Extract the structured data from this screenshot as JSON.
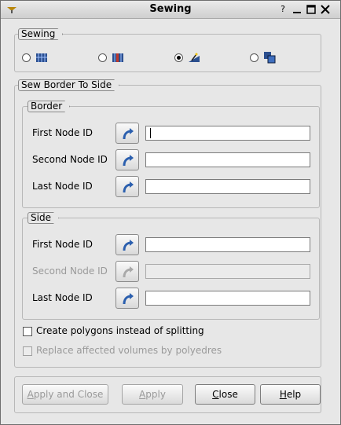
{
  "window": {
    "title": "Sewing",
    "help_label": "?",
    "controls": [
      "help",
      "minimize",
      "maximize",
      "close"
    ]
  },
  "sewing_group": {
    "legend": "Sewing",
    "options": [
      {
        "icon": "free-borders-icon",
        "selected": false
      },
      {
        "icon": "conform-free-borders-icon",
        "selected": false
      },
      {
        "icon": "border-to-side-icon",
        "selected": true
      },
      {
        "icon": "side-elements-icon",
        "selected": false
      }
    ]
  },
  "sew_group": {
    "legend": "Sew Border To Side",
    "border": {
      "legend": "Border",
      "rows": [
        {
          "label": "First Node ID",
          "value": "",
          "enabled": true
        },
        {
          "label": "Second Node ID",
          "value": "",
          "enabled": true
        },
        {
          "label": "Last Node ID",
          "value": "",
          "enabled": true
        }
      ]
    },
    "side": {
      "legend": "Side",
      "rows": [
        {
          "label": "First Node ID",
          "value": "",
          "enabled": true
        },
        {
          "label": "Second Node ID",
          "value": "",
          "enabled": false
        },
        {
          "label": "Last Node ID",
          "value": "",
          "enabled": true
        }
      ]
    },
    "options": {
      "create_polygons": {
        "label": "Create polygons instead of splitting",
        "checked": false,
        "enabled": true
      },
      "replace_volumes": {
        "label": "Replace affected volumes by polyedres",
        "checked": false,
        "enabled": false
      }
    }
  },
  "buttons": {
    "apply_close": {
      "label_u": "A",
      "label_rest": "pply and Close",
      "enabled": false
    },
    "apply": {
      "label_u": "A",
      "label_rest": "pply",
      "enabled": false
    },
    "close": {
      "label_u": "C",
      "label_rest": "lose",
      "enabled": true
    },
    "help": {
      "label_u": "H",
      "label_rest": "elp",
      "enabled": true
    }
  },
  "colors": {
    "accent_blue": "#2b4f8f",
    "disabled_text": "#9a9a9a"
  }
}
